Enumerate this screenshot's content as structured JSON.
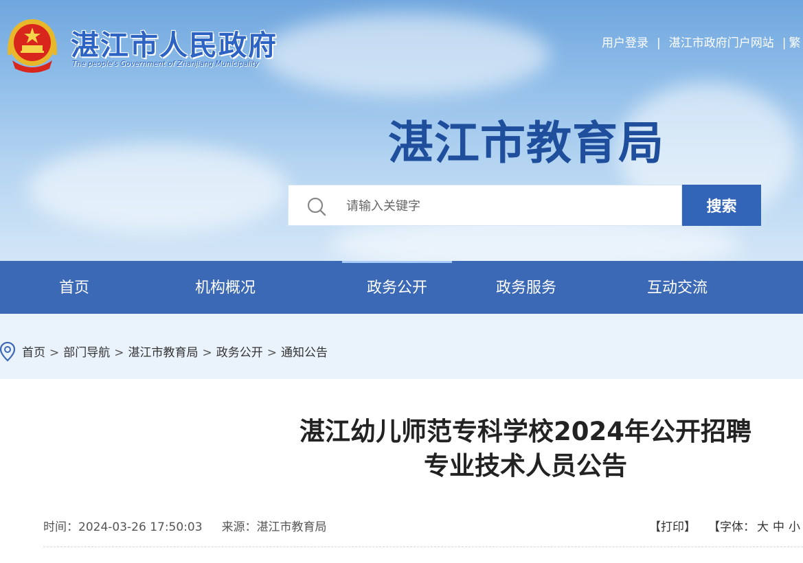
{
  "header": {
    "gov_name": "湛江市人民政府",
    "gov_subtitle": "The people's Government of Zhanjiang Municipality",
    "top_links": [
      "用户登录",
      "湛江市政府门户网站",
      "繁"
    ],
    "bureau_name": "湛江市教育局"
  },
  "search": {
    "placeholder": "请输入关键字",
    "button_label": "搜索"
  },
  "nav": {
    "items": [
      "首页",
      "机构概况",
      "政务公开",
      "政务服务",
      "互动交流"
    ],
    "active_index": 2
  },
  "breadcrumb": [
    "首页",
    "部门导航",
    "湛江市教育局",
    "政务公开",
    "通知公告"
  ],
  "article": {
    "title_line1": "湛江幼儿师范专科学校2024年公开招聘",
    "title_line2": "专业技术人员公告",
    "time_label": "时间：",
    "time_value": "2024-03-26 17:50:03",
    "source_label": "来源：",
    "source_value": "湛江市教育局",
    "print_label": "【打印】",
    "font_label": "【字体：",
    "font_sizes": [
      "大",
      "中",
      "小"
    ]
  },
  "colors": {
    "nav_bg": "#3c69b6",
    "search_button": "#3264b8",
    "bureau_title": "#1f4f9c",
    "breadcrumb_bg": "#eaf2fb"
  }
}
